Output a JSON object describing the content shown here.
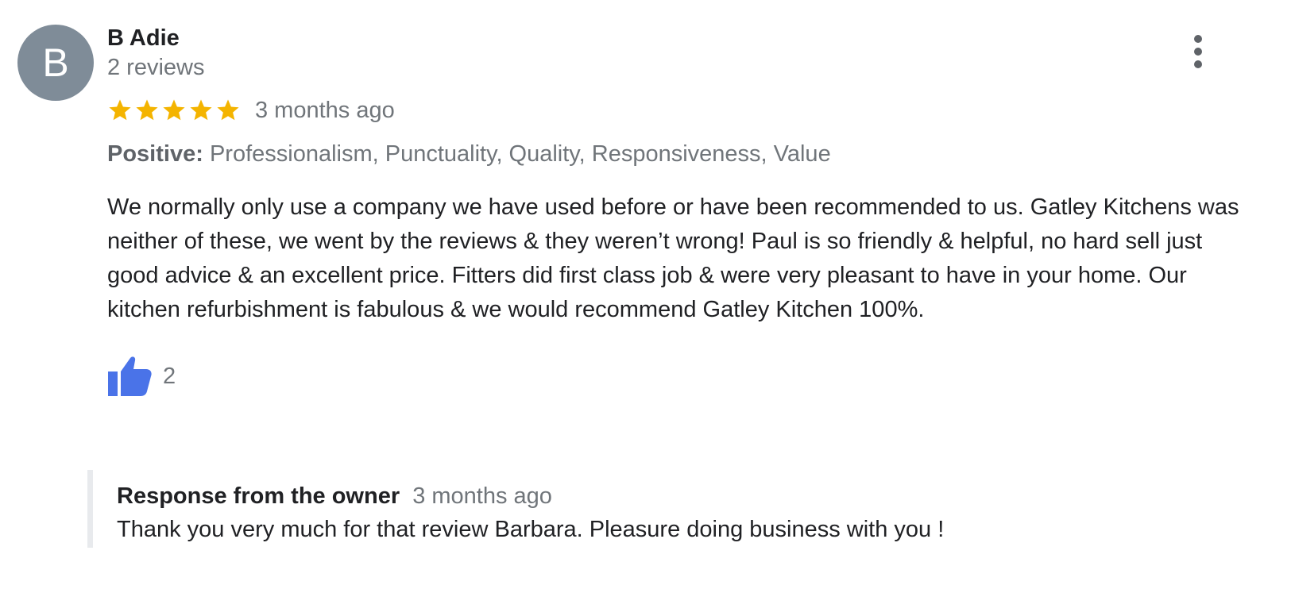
{
  "review": {
    "avatar_letter": "B",
    "author_name": "B Adie",
    "author_meta": "2 reviews",
    "rating": 5,
    "max_rating": 5,
    "date": "3 months ago",
    "highlights_label": "Positive:",
    "highlights_text": "Professionalism, Punctuality, Quality, Responsiveness, Value",
    "text": "We normally only use a company we have used before or have been recommended to us. Gatley Kitchens was neither of these, we went by the reviews & they weren’t wrong! Paul is so friendly & helpful, no hard sell just good advice & an excellent price. Fitters did first class job & were very pleasant to have in your home. Our kitchen refurbishment is fabulous & we would recommend Gatley Kitchen 100%.",
    "like_count": "2",
    "more_icon": "more-vert-icon",
    "like_icon": "thumbs-up-icon",
    "colors": {
      "avatar_bg": "#7f8c98",
      "star": "#f4b400",
      "like": "#4a73e8",
      "secondary_text": "#70757a"
    }
  },
  "owner_response": {
    "title": "Response from the owner",
    "date": "3 months ago",
    "text": "Thank you very much for that review Barbara. Pleasure doing business with you !"
  }
}
